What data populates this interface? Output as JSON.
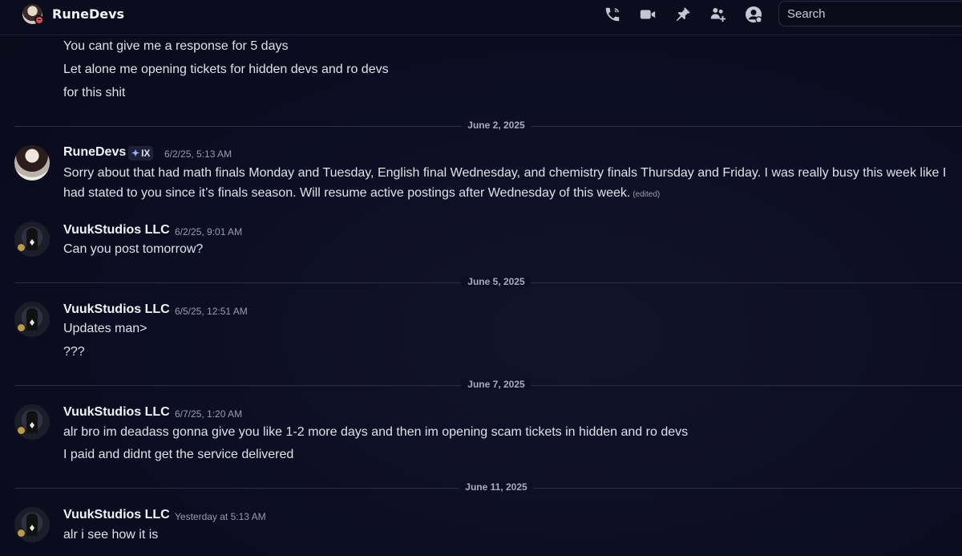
{
  "header": {
    "channel_name": "RuneDevs",
    "search_placeholder": "Search",
    "icons": [
      "phone-call-icon",
      "video-call-icon",
      "pin-icon",
      "add-friend-icon",
      "user-profile-icon"
    ]
  },
  "messages": {
    "continued": {
      "lines": [
        "You cant give me a response for 5 days",
        "Let alone me opening tickets for hidden devs and ro devs",
        "for this shit"
      ]
    },
    "dividers": [
      "June 2, 2025",
      "June 5, 2025",
      "June 7, 2025",
      "June 11, 2025"
    ],
    "rune_1": {
      "author": "RuneDevs",
      "tag": "IX",
      "timestamp": "6/2/25, 5:13 AM",
      "text": "Sorry about that had math finals Monday and Tuesday, English final Wednesday, and chemistry finals Thursday and Friday. I was really busy this week like I had stated to you since it’s finals season. Will resume active postings after Wednesday of this week.",
      "edited": "(edited)"
    },
    "vuuk_1": {
      "author": "VuukStudios LLC",
      "timestamp": "6/2/25, 9:01 AM",
      "lines": [
        "Can you post tomorrow?"
      ]
    },
    "vuuk_2": {
      "author": "VuukStudios LLC",
      "timestamp": "6/5/25, 12:51 AM",
      "lines": [
        "Updates man>",
        "???"
      ]
    },
    "vuuk_3": {
      "author": "VuukStudios LLC",
      "timestamp": "6/7/25, 1:20 AM",
      "lines": [
        "alr bro im deadass gonna give you like 1-2 more days and then im opening scam tickets in hidden and ro devs",
        "I paid and didnt get the service delivered"
      ]
    },
    "vuuk_4": {
      "author": "VuukStudios LLC",
      "timestamp": "Yesterday at 5:13 AM",
      "lines": [
        "alr i see how it is"
      ]
    }
  },
  "colors": {
    "background": "#0c0d22",
    "text": "#dfe1e8",
    "muted": "#9a9cab",
    "divider": "#2c2e45",
    "dnd_status": "#e24b4f"
  }
}
